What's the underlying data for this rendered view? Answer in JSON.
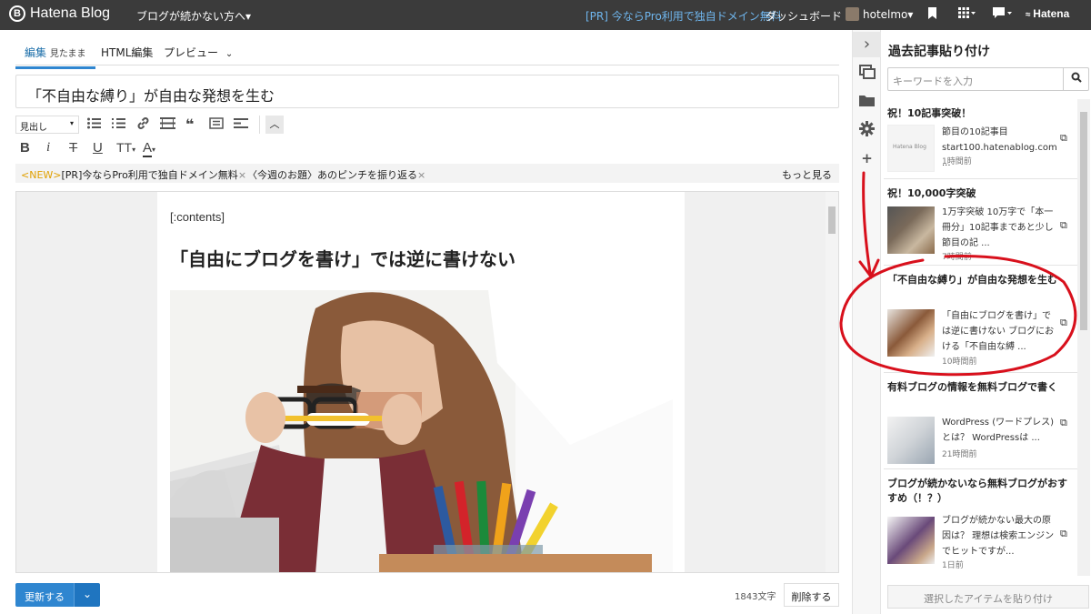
{
  "topbar": {
    "logo": "Hatena Blog",
    "logo_mark": "B",
    "blog_selector": "ブログが続かない方へ▾",
    "pr_link": "[PR] 今ならPro利用で独自ドメイン無料",
    "dashboard": "ダッシュボード",
    "username": "hotelmo▾",
    "hatena": "Hatena",
    "icons": [
      "bookmark-icon",
      "grid-icon",
      "chat-icon"
    ]
  },
  "editor": {
    "tabs": {
      "edit_label": "編集",
      "edit_sub": "見たまま",
      "html": "HTML編集",
      "preview": "プレビュー"
    },
    "title": "「不自由な縛り」が自由な発想を生む",
    "toolbar": {
      "heading_select": "見出し",
      "icons": [
        "bullet-list-icon",
        "number-list-icon",
        "link-icon",
        "table-icon",
        "quote-icon",
        "image-list-icon",
        "more-icon"
      ],
      "format": {
        "bold": "B",
        "italic": "i",
        "strike": "T",
        "underline": "U",
        "size": "TT",
        "color": "A"
      }
    },
    "newsbar": {
      "new_tag": "<NEW>",
      "item1": "[PR]今ならPro利用で独自ドメイン無料",
      "item2": "〈今週のお題〉あのピンチを振り返る",
      "close": "×",
      "more": "もっと見る"
    },
    "body": {
      "contents_tag": "[:contents]",
      "heading": "「自由にブログを書け」では逆に書けない"
    },
    "footer": {
      "update_button": "更新する",
      "char_count": "1843文字",
      "delete_button": "削除する"
    }
  },
  "sidebar": {
    "title": "過去記事貼り付け",
    "search_placeholder": "キーワードを入力",
    "paste_button": "選択したアイテムを貼り付け",
    "items": [
      {
        "title": "祝！10記事突破！",
        "desc": "節目の10記事目 start100.hatenablog.com ...",
        "time": "1時間前",
        "thumb_label": "Hatena Blog"
      },
      {
        "title": "祝！10,000字突破",
        "desc": "1万字突破 10万字で「本一冊分」10記事まであと少し 節目の記 ...",
        "time": "7時間前",
        "thumb_label": ""
      },
      {
        "title": "「不自由な縛り」が自由な発想を生む",
        "desc": "「自由にブログを書け」では逆に書けない ブログにおける「不自由な縛 ...",
        "time": "10時間前",
        "thumb_label": ""
      },
      {
        "title": "有料ブログの情報を無料ブログで書く",
        "desc": "WordPress (ワードプレス) とは？ WordPressは ...",
        "time": "21時間前",
        "thumb_label": ""
      },
      {
        "title": "ブログが続かないなら無料ブログがおすすめ（！？）",
        "desc": "ブログが続かない最大の原因は？ 理想は検索エンジンでヒットですが...",
        "time": "1日前",
        "thumb_label": ""
      }
    ]
  },
  "colors": {
    "topbar_bg": "#3b3b3b",
    "accent_blue": "#2f86d0",
    "annotation_red": "#d8101c"
  }
}
